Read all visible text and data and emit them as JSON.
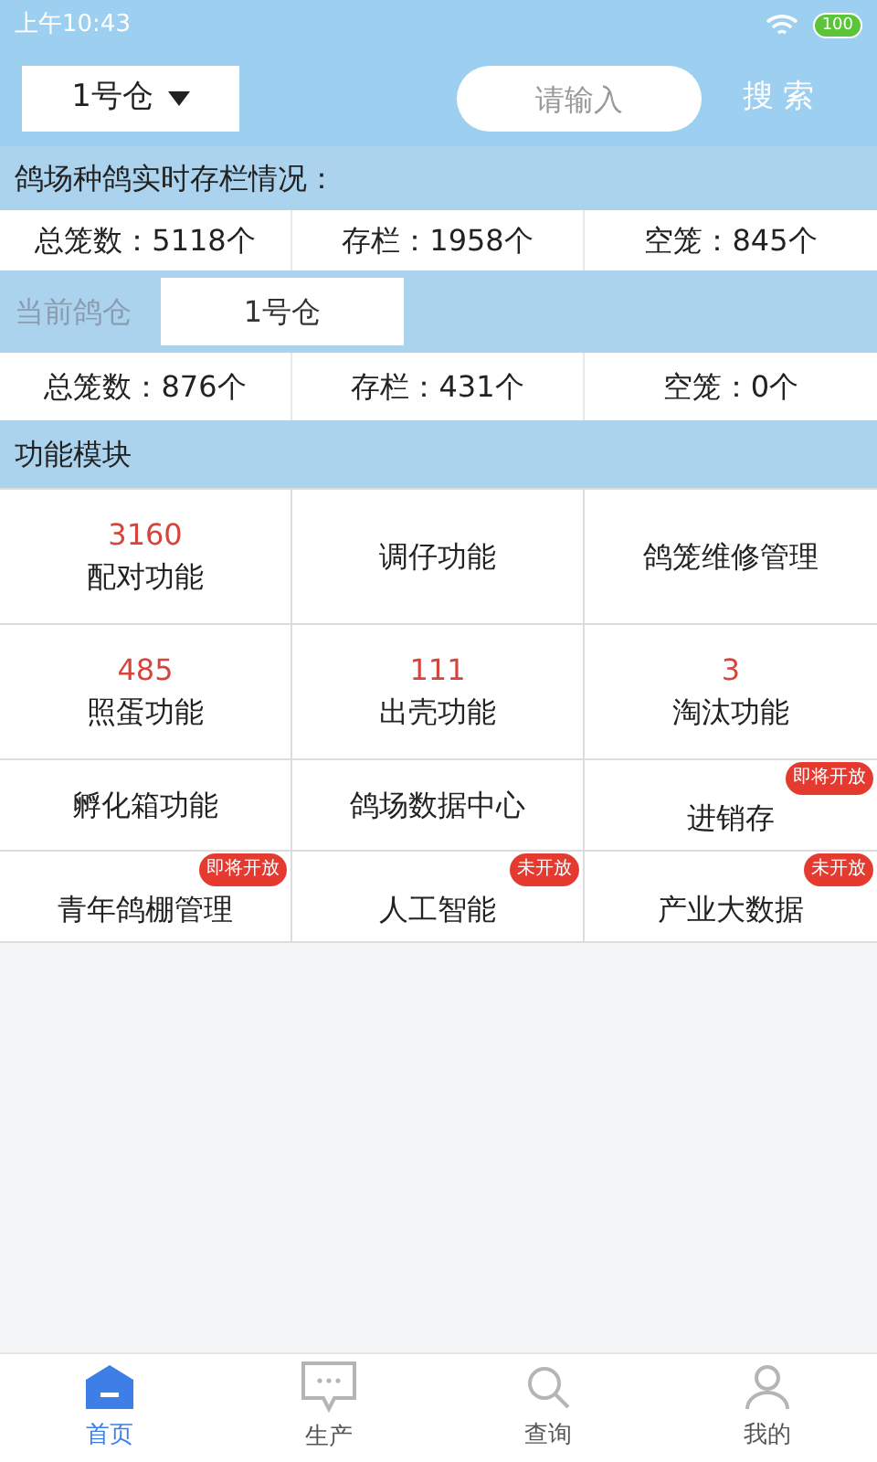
{
  "status_bar": {
    "time": "上午10:43",
    "battery": "100"
  },
  "header": {
    "warehouse_select": "1号仓",
    "search": {
      "placeholder": "请输入"
    },
    "search_button": "搜 索"
  },
  "overview": {
    "title": "鸽场种鸽实时存栏情况：",
    "stats": [
      "总笼数：5118个",
      "存栏：1958个",
      "空笼：845个"
    ]
  },
  "current_warehouse": {
    "label": "当前鸽仓",
    "value": "1号仓",
    "stats": [
      "总笼数：876个",
      "存栏：431个",
      "空笼：0个"
    ]
  },
  "modules": {
    "title": "功能模块",
    "items": [
      {
        "label": "配对功能",
        "count": "3160"
      },
      {
        "label": "调仔功能"
      },
      {
        "label": "鸽笼维修管理"
      },
      {
        "label": "照蛋功能",
        "count": "485"
      },
      {
        "label": "出壳功能",
        "count": "111"
      },
      {
        "label": "淘汰功能",
        "count": "3"
      },
      {
        "label": "孵化箱功能"
      },
      {
        "label": "鸽场数据中心"
      },
      {
        "label": "进销存",
        "badge": "即将开放"
      },
      {
        "label": "青年鸽棚管理",
        "badge": "即将开放"
      },
      {
        "label": "人工智能",
        "badge": "未开放"
      },
      {
        "label": "产业大数据",
        "badge": "未开放"
      }
    ]
  },
  "tab_bar": [
    {
      "label": "首页",
      "selected": true,
      "kind": "home"
    },
    {
      "label": "生产",
      "selected": false,
      "kind": "chat"
    },
    {
      "label": "查询",
      "selected": false,
      "kind": "search"
    },
    {
      "label": "我的",
      "selected": false,
      "kind": "user"
    }
  ]
}
